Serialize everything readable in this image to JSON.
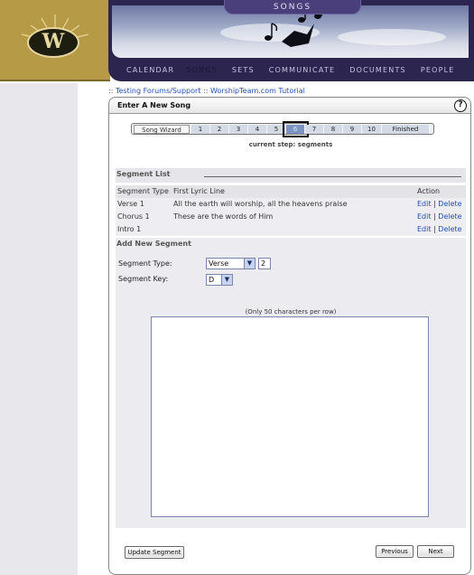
{
  "header": {
    "section_title": "SONGS",
    "nav": [
      "CALENDAR",
      "SONGS",
      "SETS",
      "COMMUNICATE",
      "DOCUMENTS",
      "PEOPLE"
    ],
    "active_nav": "SONGS"
  },
  "breadcrumb": {
    "sep": "::",
    "items": [
      "Testing Forums/Support",
      "WorshipTeam.com Tutorial"
    ]
  },
  "panel": {
    "title": "Enter A New Song",
    "help": "?"
  },
  "wizard": {
    "label": "Song Wizard",
    "steps": [
      "1",
      "2",
      "3",
      "4",
      "5",
      "6",
      "7",
      "8",
      "9",
      "10",
      "Finished"
    ],
    "current_step": "6",
    "caption": "current step: segments"
  },
  "segment_list": {
    "heading": "Segment List",
    "columns": [
      "Segment Type",
      "First Lyric Line",
      "Action"
    ],
    "rows": [
      {
        "type": "Verse 1",
        "first_line": "All the earth will worship, all the heavens praise",
        "edit": "Edit",
        "sep": "|",
        "delete": "Delete"
      },
      {
        "type": "Chorus 1",
        "first_line": "These are the words of Him",
        "edit": "Edit",
        "sep": "|",
        "delete": "Delete"
      },
      {
        "type": "Intro 1",
        "first_line": "",
        "edit": "Edit",
        "sep": "|",
        "delete": "Delete"
      }
    ]
  },
  "add_segment": {
    "heading": "Add New Segment",
    "type_label": "Segment Type:",
    "type_value": "Verse",
    "number_value": "2",
    "key_label": "Segment Key:",
    "key_value": "D",
    "char_note": "(Only 50 characters per row)",
    "lyrics_value": ""
  },
  "buttons": {
    "update": "Update Segment",
    "previous": "Previous",
    "next": "Next"
  },
  "colors": {
    "banner_navy": "#2b2550",
    "logo_gold": "#b69a46",
    "link_blue": "#2250b0",
    "current_step": "#7c93c4"
  },
  "icons": {
    "help": "question-circle-icon",
    "dropdown": "chevron-down-icon"
  }
}
